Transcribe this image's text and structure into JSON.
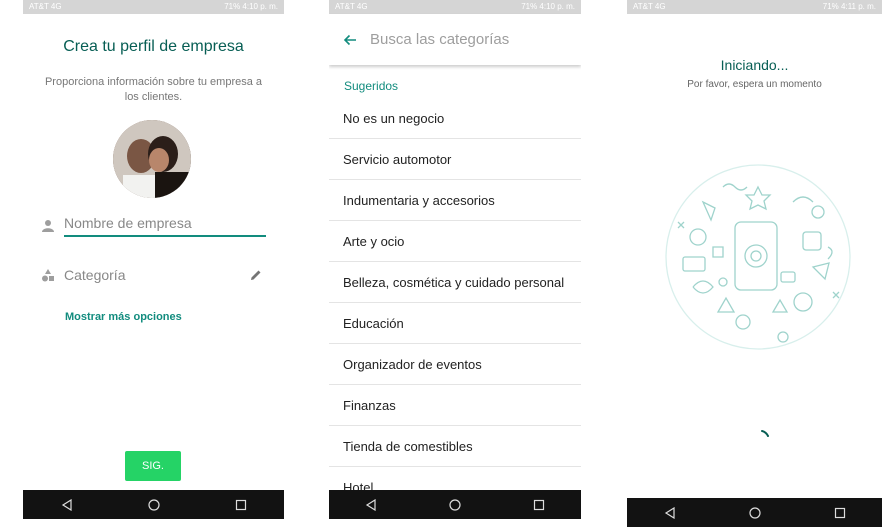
{
  "status_bar": {
    "screen1": {
      "carrier": "AT&T 4G",
      "right": "71% 4:10 p. m."
    },
    "screen2": {
      "carrier": "AT&T 4G",
      "right": "71% 4:10 p. m."
    },
    "screen3": {
      "carrier": "AT&T 4G",
      "right": "71% 4:11 p. m."
    }
  },
  "screen1": {
    "title": "Crea tu perfil de empresa",
    "subtitle": "Proporciona información sobre tu empresa a los clientes.",
    "name_field": {
      "placeholder": "Nombre de empresa"
    },
    "category_field": {
      "placeholder": "Categoría"
    },
    "more_options": "Mostrar más opciones",
    "next_button": "SIG."
  },
  "screen2": {
    "search_placeholder": "Busca las categorías",
    "section_label": "Sugeridos",
    "categories": [
      "No es un negocio",
      "Servicio automotor",
      "Indumentaria y accesorios",
      "Arte y ocio",
      "Belleza, cosmética y cuidado personal",
      "Educación",
      "Organizador de eventos",
      "Finanzas",
      "Tienda de comestibles",
      "Hotel"
    ]
  },
  "screen3": {
    "title": "Iniciando...",
    "subtitle": "Por favor, espera un momento"
  },
  "colors": {
    "brand_dark": "#075e54",
    "accent": "#128c7e",
    "button_green": "#25d366",
    "status_bar": "#d5d5d5",
    "nav_bar": "#121212"
  },
  "icons": {
    "nav": [
      "back-triangle-icon",
      "home-circle-icon",
      "recents-square-icon"
    ],
    "fields": [
      "person-icon",
      "shapes-icon",
      "pencil-icon"
    ]
  }
}
